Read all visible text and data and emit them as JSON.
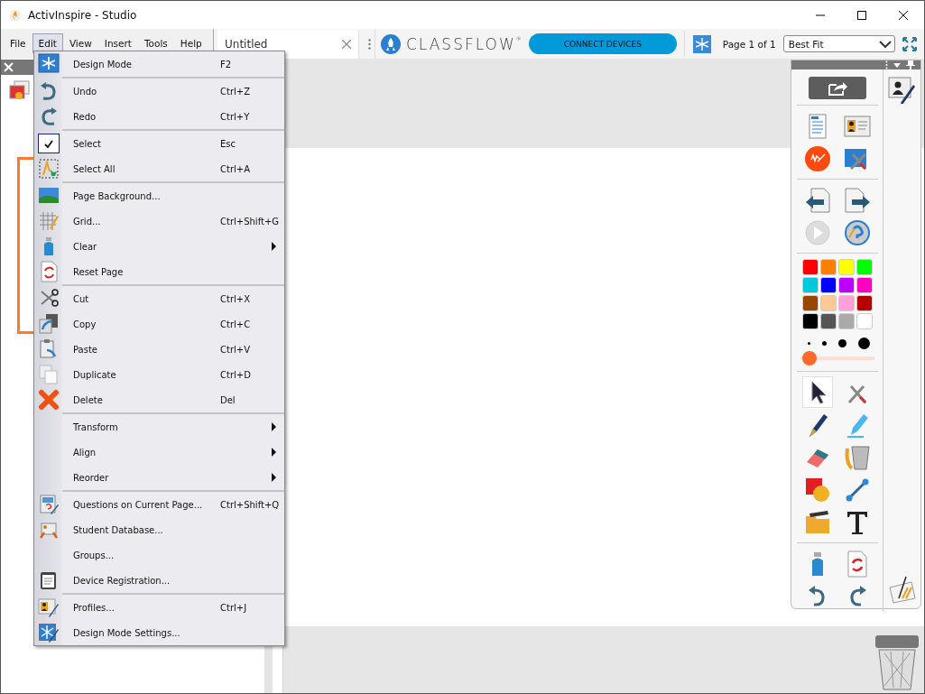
{
  "window": {
    "title": "ActivInspire - Studio"
  },
  "menubar": [
    {
      "label": "File",
      "selected": false
    },
    {
      "label": "Edit",
      "selected": true
    },
    {
      "label": "View",
      "selected": false
    },
    {
      "label": "Insert",
      "selected": false
    },
    {
      "label": "Tools",
      "selected": false
    },
    {
      "label": "Help",
      "selected": false
    }
  ],
  "document_tabs": [
    {
      "label": "Untitled",
      "selected": true
    }
  ],
  "classflow": {
    "logo": "CLASSFLOW",
    "mark": "®",
    "button": "CONNECT DEVICES"
  },
  "page_indicator": "Page 1 of 1",
  "zoom_select": {
    "value": "Best Fit"
  },
  "edit_menu": {
    "groups": [
      [
        {
          "label": "Design Mode",
          "shortcut": "F2",
          "checked": false,
          "submenu": false
        }
      ],
      [
        {
          "label": "Undo",
          "shortcut": "Ctrl+Z",
          "checked": false,
          "submenu": false
        },
        {
          "label": "Redo",
          "shortcut": "Ctrl+Y",
          "checked": false,
          "submenu": false
        }
      ],
      [
        {
          "label": "Select",
          "shortcut": "Esc",
          "checked": true,
          "submenu": false
        },
        {
          "label": "Select All",
          "shortcut": "Ctrl+A",
          "checked": false,
          "submenu": false
        }
      ],
      [
        {
          "label": "Page Background...",
          "checked": false,
          "submenu": false
        },
        {
          "label": "Grid...",
          "shortcut": "Ctrl+Shift+G",
          "checked": false,
          "submenu": false
        },
        {
          "label": "Clear",
          "checked": false,
          "submenu": true
        },
        {
          "label": "Reset Page",
          "checked": false,
          "submenu": false
        }
      ],
      [
        {
          "label": "Cut",
          "shortcut": "Ctrl+X",
          "checked": false,
          "submenu": false
        },
        {
          "label": "Copy",
          "shortcut": "Ctrl+C",
          "checked": false,
          "submenu": false
        },
        {
          "label": "Paste",
          "shortcut": "Ctrl+V",
          "checked": false,
          "submenu": false
        },
        {
          "label": "Duplicate",
          "shortcut": "Ctrl+D",
          "checked": false,
          "submenu": false
        },
        {
          "label": "Delete",
          "shortcut": "Del",
          "checked": false,
          "submenu": false
        }
      ],
      [
        {
          "label": "Transform",
          "checked": false,
          "submenu": true
        },
        {
          "label": "Align",
          "checked": false,
          "submenu": true
        },
        {
          "label": "Reorder",
          "checked": false,
          "submenu": true
        }
      ],
      [
        {
          "label": "Questions on Current Page...",
          "shortcut": "Ctrl+Shift+Q",
          "checked": false,
          "submenu": false
        },
        {
          "label": "Student Database...",
          "checked": false,
          "submenu": false
        },
        {
          "label": "Groups...",
          "checked": false,
          "submenu": false
        },
        {
          "label": "Device Registration...",
          "checked": false,
          "submenu": false
        }
      ],
      [
        {
          "label": "Profiles...",
          "shortcut": "Ctrl+J",
          "checked": false,
          "submenu": false
        },
        {
          "label": "Design Mode Settings...",
          "checked": false,
          "submenu": false
        }
      ]
    ]
  },
  "toolbox": {
    "colors": [
      {
        "color": "#ff0000"
      },
      {
        "color": "#ff8000"
      },
      {
        "color": "#ffff00"
      },
      {
        "color": "#00ff00"
      },
      {
        "color": "#00c8dc"
      },
      {
        "color": "#0000ff"
      },
      {
        "color": "#c000ff"
      },
      {
        "color": "#ff00c0"
      },
      {
        "color": "#964800"
      },
      {
        "color": "#ffc896"
      },
      {
        "color": "#ffa0dc"
      },
      {
        "color": "#b40000"
      },
      {
        "color": "#000000"
      },
      {
        "color": "#555555"
      },
      {
        "color": "#aaaaaa"
      },
      {
        "color": "#ffffff"
      }
    ],
    "width_slider": {
      "level": 0.04
    },
    "tools": [
      {
        "selected": true
      },
      {
        "selected": false
      },
      {
        "selected": false
      },
      {
        "selected": false
      },
      {
        "selected": false
      },
      {
        "selected": false
      },
      {
        "selected": false
      },
      {
        "selected": false
      },
      {
        "selected": false
      },
      {
        "selected": false
      }
    ]
  }
}
